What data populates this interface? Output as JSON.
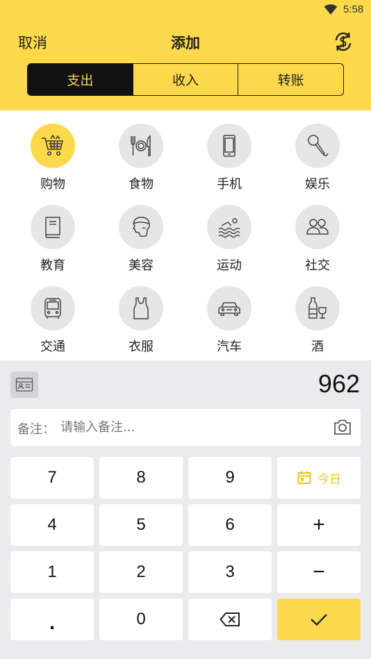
{
  "status_bar": {
    "time": "5:58"
  },
  "header": {
    "cancel_label": "取消",
    "title": "添加",
    "tabs": [
      {
        "label": "支出",
        "active": true
      },
      {
        "label": "收入",
        "active": false
      },
      {
        "label": "转账",
        "active": false
      }
    ]
  },
  "categories": [
    {
      "label": "购物",
      "icon": "shopping-cart-icon",
      "selected": true
    },
    {
      "label": "食物",
      "icon": "fork-plate-knife-icon",
      "selected": false
    },
    {
      "label": "手机",
      "icon": "phone-icon",
      "selected": false
    },
    {
      "label": "娱乐",
      "icon": "microphone-icon",
      "selected": false
    },
    {
      "label": "教育",
      "icon": "book-icon",
      "selected": false
    },
    {
      "label": "美容",
      "icon": "face-icon",
      "selected": false
    },
    {
      "label": "运动",
      "icon": "swimming-icon",
      "selected": false
    },
    {
      "label": "社交",
      "icon": "people-icon",
      "selected": false
    },
    {
      "label": "交通",
      "icon": "bus-icon",
      "selected": false
    },
    {
      "label": "衣服",
      "icon": "tank-top-icon",
      "selected": false
    },
    {
      "label": "汽车",
      "icon": "car-icon",
      "selected": false
    },
    {
      "label": "酒",
      "icon": "wine-bottle-glass-icon",
      "selected": false
    }
  ],
  "amount": "962",
  "note": {
    "label": "备注：",
    "placeholder": "请输入备注..."
  },
  "keypad": {
    "k7": "7",
    "k8": "8",
    "k9": "9",
    "today": "今日",
    "k4": "4",
    "k5": "5",
    "k6": "6",
    "plus": "+",
    "k1": "1",
    "k2": "2",
    "k3": "3",
    "minus": "−",
    "dot": ".",
    "k0": "0"
  },
  "colors": {
    "accent": "#fdd94b",
    "today_text": "#f5c31a",
    "active_tab_bg": "#111111"
  }
}
